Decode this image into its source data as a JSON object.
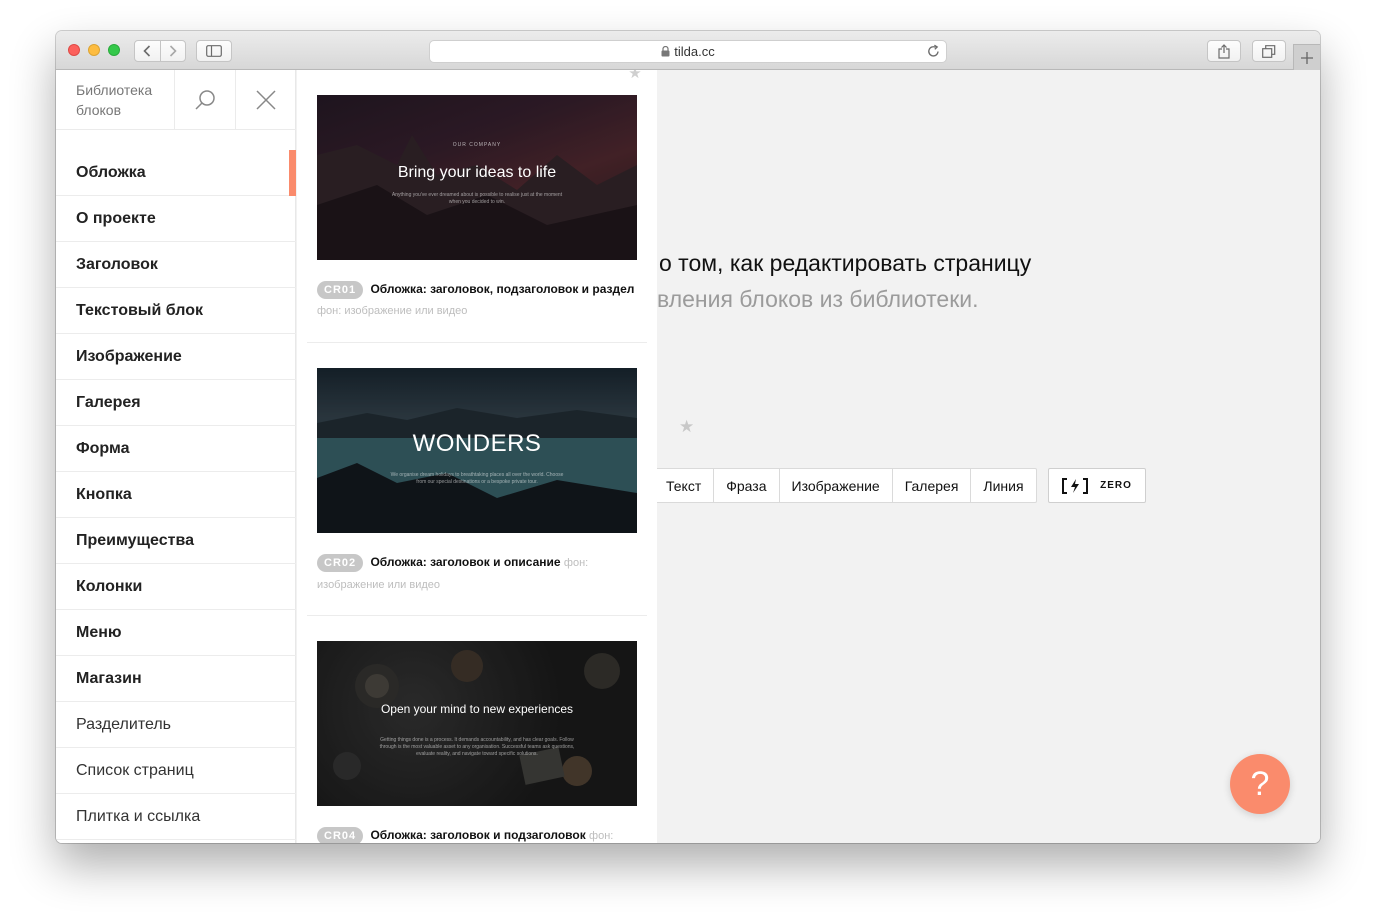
{
  "browser": {
    "url": "tilda.cc"
  },
  "library": {
    "title": "Библиотека блоков",
    "categories": [
      {
        "label": "Обложка",
        "active": true,
        "weight": "bold"
      },
      {
        "label": "О проекте",
        "weight": "bold"
      },
      {
        "label": "Заголовок",
        "weight": "bold"
      },
      {
        "label": "Текстовый блок",
        "weight": "bold"
      },
      {
        "label": "Изображение",
        "weight": "bold"
      },
      {
        "label": "Галерея",
        "weight": "bold"
      },
      {
        "label": "Форма",
        "weight": "bold"
      },
      {
        "label": "Кнопка",
        "weight": "bold"
      },
      {
        "label": "Преимущества",
        "weight": "bold"
      },
      {
        "label": "Колонки",
        "weight": "bold"
      },
      {
        "label": "Меню",
        "weight": "bold"
      },
      {
        "label": "Магазин",
        "weight": "bold"
      },
      {
        "label": "Разделитель",
        "weight": "light"
      },
      {
        "label": "Список страниц",
        "weight": "light"
      },
      {
        "label": "Плитка и ссылка",
        "weight": "light"
      }
    ],
    "blocks": [
      {
        "code": "CR01",
        "title": "Обложка: заголовок, подзаголовок и раздел",
        "meta": "фон: изображение или видео",
        "preview": {
          "small": "OUR COMPANY",
          "headline": "Bring your ideas to life",
          "desc": "Anything you've ever dreamed about is possible to realise just at the moment when you decided to win."
        }
      },
      {
        "code": "CR02",
        "title": "Обложка: заголовок и описание",
        "meta": "фон: изображение или видео",
        "preview": {
          "headline": "WONDERS",
          "desc": "We organise dream holidays to breathtaking places all over the world. Choose from our special destinations or a bespoke private tour."
        }
      },
      {
        "code": "CR04",
        "title": "Обложка: заголовок и подзаголовок",
        "meta": "фон:",
        "preview": {
          "headline": "Open your mind to new experiences",
          "desc": "Getting things done is a process. It demands accountability, and has clear goals. Follow through is the most valuable asset to any organisation. Successful teams ask questions, evaluate reality, and navigate toward specific solutions."
        }
      }
    ]
  },
  "page": {
    "heading": "о том, как редактировать страницу",
    "subheading": "вления блоков из библиотеки.",
    "block_types": [
      "Текст",
      "Фраза",
      "Изображение",
      "Галерея",
      "Линия"
    ],
    "zero_label": "ZERO",
    "help_label": "?"
  }
}
